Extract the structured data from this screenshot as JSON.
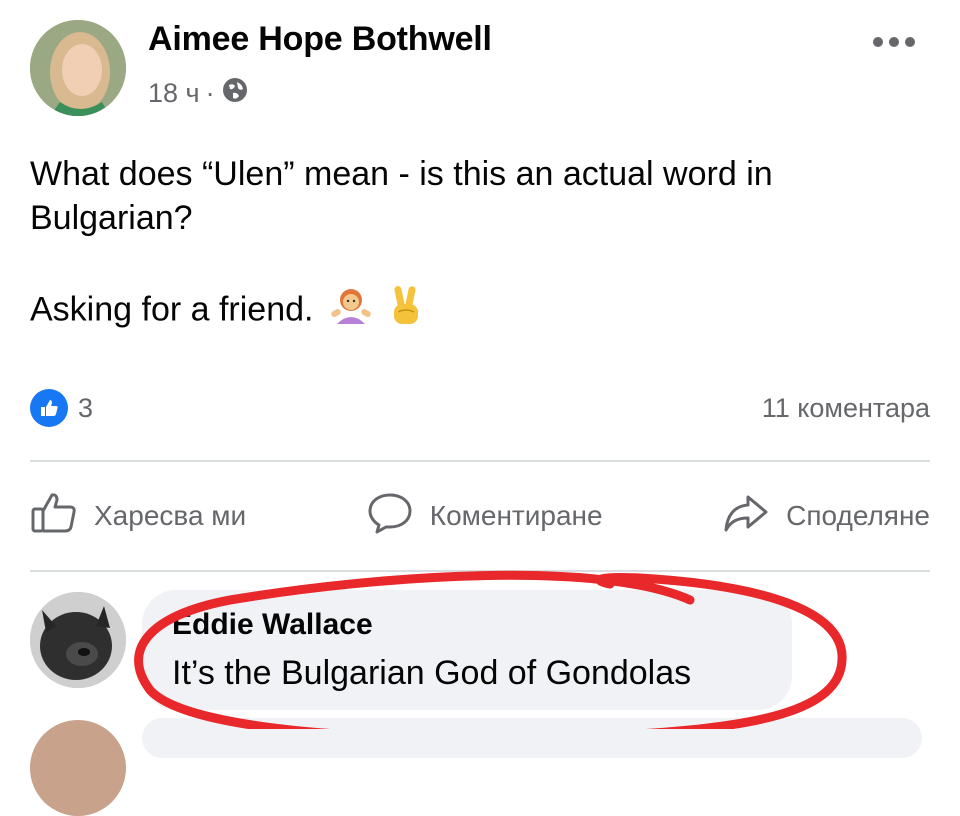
{
  "post": {
    "author": "Aimee Hope Bothwell",
    "time": "18 ч",
    "separator": "·",
    "privacy_icon": "globe-icon",
    "text_line1": "What does “Ulen” mean - is this an actual word in",
    "text_line2": "Bulgarian?",
    "text_line3": "Asking for a friend.",
    "emojis": [
      "person-shrugging-emoji",
      "victory-hand-emoji"
    ]
  },
  "stats": {
    "like_count": "3",
    "comments_label": "11 коментара"
  },
  "actions": {
    "like_label": "Харесва ми",
    "comment_label": "Коментиране",
    "share_label": "Споделяне"
  },
  "comment": {
    "author": "Eddie Wallace",
    "text": "It’s the Bulgarian God of Gondolas"
  },
  "colors": {
    "like_blue": "#1877f2",
    "secondary_text": "#65676b",
    "bubble_bg": "#f0f2f5",
    "annotation_red": "#e8282b"
  }
}
